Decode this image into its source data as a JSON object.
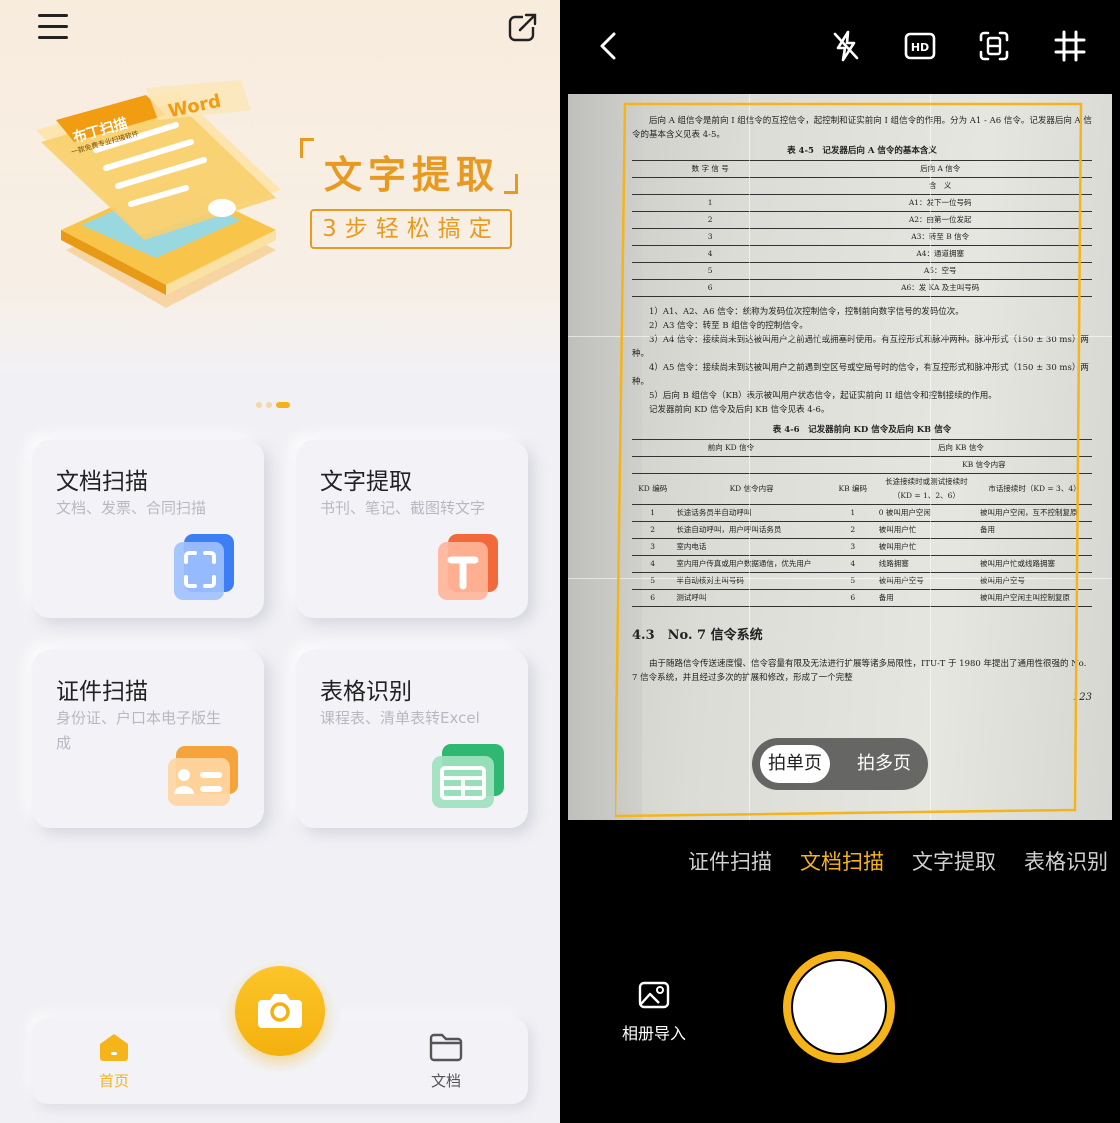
{
  "home": {
    "banner": {
      "title": "文字提取",
      "subtitle": "3步轻松搞定",
      "book_brand": "布丁扫描",
      "book_tagline": "一款免费专业扫描软件",
      "book_word": "Word"
    },
    "carousel": {
      "count": 3,
      "active_index": 2
    },
    "cards": [
      {
        "title": "文档扫描",
        "subtitle": "文档、发票、合同扫描"
      },
      {
        "title": "文字提取",
        "subtitle": "书刊、笔记、截图转文字"
      },
      {
        "title": "证件扫描",
        "subtitle": "身份证、户口本电子版生成"
      },
      {
        "title": "表格识别",
        "subtitle": "课程表、清单表转Excel"
      }
    ],
    "tabbar": {
      "home": "首页",
      "docs": "文档"
    },
    "colors": {
      "accent": "#f5b41a",
      "background": "#f1f1f5"
    }
  },
  "camera": {
    "mode_toggle": {
      "single": "拍单页",
      "multi": "拍多页"
    },
    "mode_tabs": [
      "证件扫描",
      "文档扫描",
      "文字提取",
      "表格识别"
    ],
    "active_mode": "文档扫描",
    "album_label": "相册导入",
    "top_icons": [
      "back-icon",
      "flash-off-icon",
      "hd-icon",
      "scan-mode-icon",
      "grid-icon"
    ],
    "document": {
      "intro": "后向 A 组信令是前向 I 组信令的互控信令，起控制和证实前向 I 组信令的作用。分为 A1 - A6 信令。记发器后向 A 信令的基本含义见表 4-5。",
      "table1_caption": "表 4-5　记发器后向 A 信令的基本含义",
      "table1_header": [
        "数 字 信 号",
        "后向 A 信令"
      ],
      "table1_subheader": "含　义",
      "table1_rows": [
        [
          "1",
          "A1：发下一位号码"
        ],
        [
          "2",
          "A2：由第一位发起"
        ],
        [
          "3",
          "A3：转至 B 信令"
        ],
        [
          "4",
          "A4：通道拥塞"
        ],
        [
          "5",
          "A5：空号"
        ],
        [
          "6",
          "A6：发 KA 及主叫号码"
        ]
      ],
      "notes": [
        "1）A1、A2、A6 信令：统称为发码位次控制信令，控制前向数字信号的发码位次。",
        "2）A3 信令：转至 B 组信令的控制信令。",
        "3）A4 信令：接续尚未到达被叫用户之前遇忙或拥塞时使用。有互控形式和脉冲两种。脉冲形式（150 ± 30 ms）两种。",
        "4）A5 信令：接续尚未到达被叫用户之前遇到空区号或空局号时的信令，有互控形式和脉冲形式（150 ± 30 ms）两种。",
        "5）后向 B 组信令（KB）表示被叫用户状态信令，起证实前向 II 组信令和控制接续的作用。",
        "记发器前向 KD 信令及后向 KB 信令见表 4-6。"
      ],
      "table2_caption": "表 4-6　记发器前向 KD 信令及后向 KB 信令",
      "table2_group": [
        "前向 KD 信令",
        "后向 KB 信令"
      ],
      "table2_header": [
        "KD 编码",
        "KD 信令内容",
        "KB 编码",
        "长途接续时或测试接续时（KD = 1、2、6）",
        "市话接续时（KD = 3、4）"
      ],
      "table2_kb_header": "KB 信令内容",
      "table2_rows": [
        [
          "1",
          "长途话务员半自动呼叫",
          "1",
          "0 被叫用户空闲",
          "被叫用户空闲，互不控制复原"
        ],
        [
          "2",
          "长途自动呼叫，用户呼叫话务员",
          "2",
          "被叫用户忙",
          "备用"
        ],
        [
          "3",
          "室内电话",
          "3",
          "被叫用户忙",
          ""
        ],
        [
          "4",
          "室内用户传真或用户数据通信，优先用户",
          "4",
          "线路拥塞",
          "被叫用户忙或线路拥塞"
        ],
        [
          "5",
          "半自动核对主叫号码",
          "5",
          "被叫用户空号",
          "被叫用户空号"
        ],
        [
          "6",
          "测试呼叫",
          "6",
          "备用",
          "被叫用户空闲主叫控制复原"
        ]
      ],
      "section": "4.3　No. 7 信令系统",
      "section_text": "由于随路信令传送速度慢、信令容量有限及无法进行扩展等诸多局限性，ITU-T 于 1980 年提出了通用性很强的 No. 7 信令系统，并且经过多次的扩展和修改，形成了一个完整",
      "page_number": "123"
    },
    "colors": {
      "accent": "#f5b41a",
      "background": "#000000"
    }
  }
}
